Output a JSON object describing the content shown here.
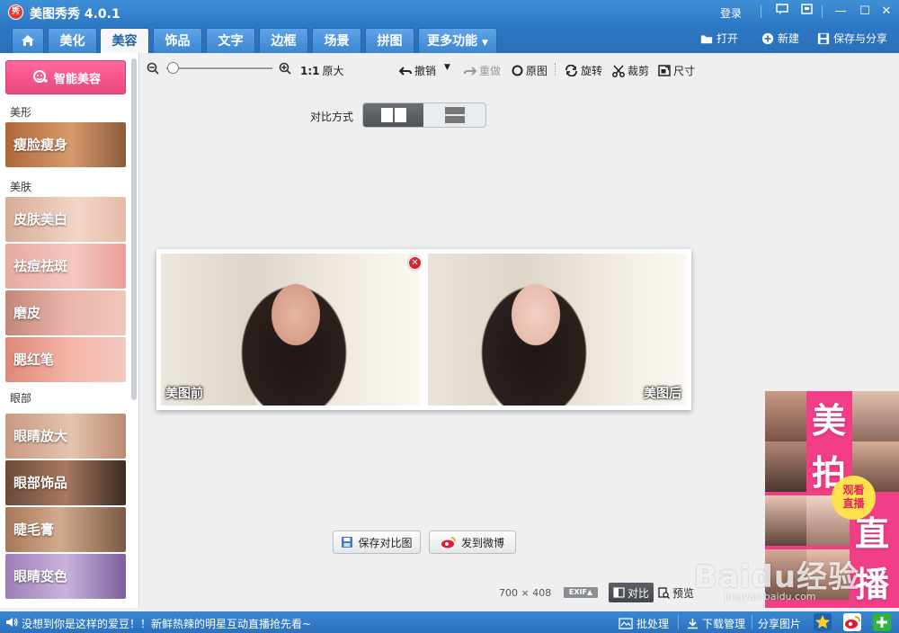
{
  "app": {
    "logo_text": "秀",
    "title": "美图秀秀 4.0.1",
    "login": "登录"
  },
  "window_controls": {
    "feedback_icon": "chat-icon",
    "skin_icon": "skin-icon",
    "minimize": "—",
    "maximize": "☐",
    "close": "✕"
  },
  "nav": {
    "tabs": [
      "美化",
      "美容",
      "饰品",
      "文字",
      "边框",
      "场景",
      "拼图",
      "更多功能"
    ],
    "active": "美容",
    "actions": {
      "open": "打开",
      "new": "新建",
      "save_share": "保存与分享"
    }
  },
  "sidebar": {
    "smart_button": "智能美容",
    "sections": [
      {
        "label": "美形",
        "items": [
          "瘦脸瘦身"
        ]
      },
      {
        "label": "美肤",
        "items": [
          "皮肤美白",
          "祛痘祛斑",
          "磨皮",
          "腮红笔"
        ]
      },
      {
        "label": "眼部",
        "items": [
          "眼睛放大",
          "眼部饰品",
          "睫毛膏",
          "眼睛变色"
        ]
      }
    ]
  },
  "toolbar": {
    "zoom_value": 0.03,
    "ratio": "1:1",
    "original_size": "原大",
    "undo": "撤销",
    "redo": "重做",
    "original": "原图",
    "rotate": "旋转",
    "crop": "裁剪",
    "size": "尺寸"
  },
  "compare": {
    "label": "对比方式",
    "modes": [
      "side-by-side",
      "stacked"
    ],
    "selected_mode": "side-by-side",
    "before_caption": "美图前",
    "after_caption": "美图后"
  },
  "actions": {
    "save_compare": "保存对比图",
    "post_weibo": "发到微博"
  },
  "image_info": {
    "width": "700",
    "x": "×",
    "height": "408",
    "exif": "EXIF▲",
    "compare": "对比",
    "preview": "预览"
  },
  "ad": {
    "chars": [
      "美",
      "拍",
      "直",
      "播"
    ],
    "badge_line1": "观看",
    "badge_line2": "直播"
  },
  "watermark": {
    "text": "Baidu经验",
    "url": "jingyan.baidu.com"
  },
  "status": {
    "message": "没想到你是这样的爱豆！！新鲜热辣的明星互动直播抢先看~",
    "batch": "批处理",
    "download": "下载管理",
    "share": "分享图片"
  },
  "colors": {
    "brand_blue": "#2d78c4",
    "accent_pink": "#ec4680",
    "ad_pink": "#f23d87"
  }
}
